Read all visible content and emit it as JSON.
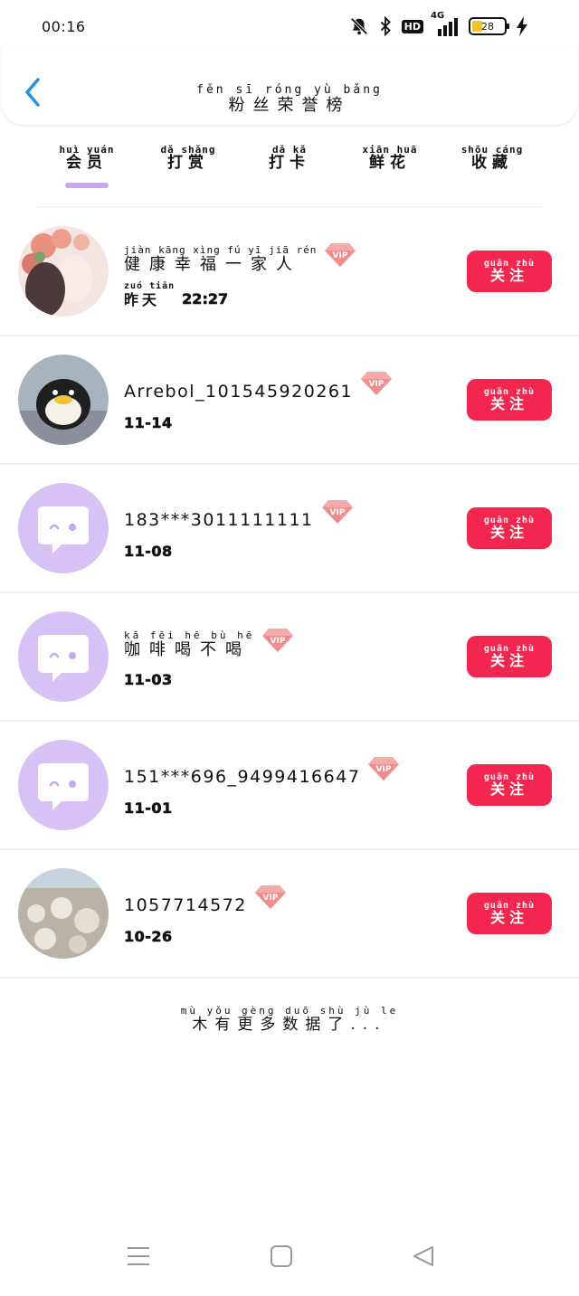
{
  "status_bar": {
    "time": "00:16",
    "network": "4G",
    "hd": "HD",
    "battery": "28"
  },
  "header": {
    "title_pinyin": "fěn sī róng yù bǎng",
    "title": "粉丝荣誉榜"
  },
  "tabs": [
    {
      "pinyin": "huì yuán",
      "label": "会员",
      "active": true
    },
    {
      "pinyin": "dǎ shǎng",
      "label": "打赏",
      "active": false
    },
    {
      "pinyin": "dǎ kǎ",
      "label": "打卡",
      "active": false
    },
    {
      "pinyin": "xiān huā",
      "label": "鲜花",
      "active": false
    },
    {
      "pinyin": "shōu cáng",
      "label": "收藏",
      "active": false
    }
  ],
  "fans": [
    {
      "name_pinyin": "jiàn kāng xìng fú yī jiā rén",
      "name": "健康幸福一家人",
      "vip": "VIP",
      "date_pinyin": "zuó tiān",
      "date_word": "昨天",
      "date": "22:27"
    },
    {
      "name_pinyin": "",
      "name": "Arrebol_101545920261",
      "vip": "VIP",
      "date_pinyin": "",
      "date_word": "",
      "date": "11-14"
    },
    {
      "name_pinyin": "",
      "name": "183***3011111111",
      "vip": "VIP",
      "date_pinyin": "",
      "date_word": "",
      "date": "11-08"
    },
    {
      "name_pinyin": "kā fēi hē bù hē",
      "name": "咖啡喝不喝",
      "vip": "VIP",
      "date_pinyin": "",
      "date_word": "",
      "date": "11-03"
    },
    {
      "name_pinyin": "",
      "name": "151***696_9499416647",
      "vip": "VIP",
      "date_pinyin": "",
      "date_word": "",
      "date": "11-01"
    },
    {
      "name_pinyin": "",
      "name": "1057714572",
      "vip": "VIP",
      "date_pinyin": "",
      "date_word": "",
      "date": "10-26"
    }
  ],
  "follow_button": {
    "pinyin": "guān zhù",
    "label": "关注"
  },
  "footer": {
    "pinyin": "mù yǒu gèng duō shù jù le",
    "text": "木有更多数据了..."
  },
  "colors": {
    "accent_purple": "#c8a9ef",
    "follow_red": "#f2264f",
    "back_blue": "#2b8fe0",
    "default_avatar_bg": "#d6c2f5"
  }
}
